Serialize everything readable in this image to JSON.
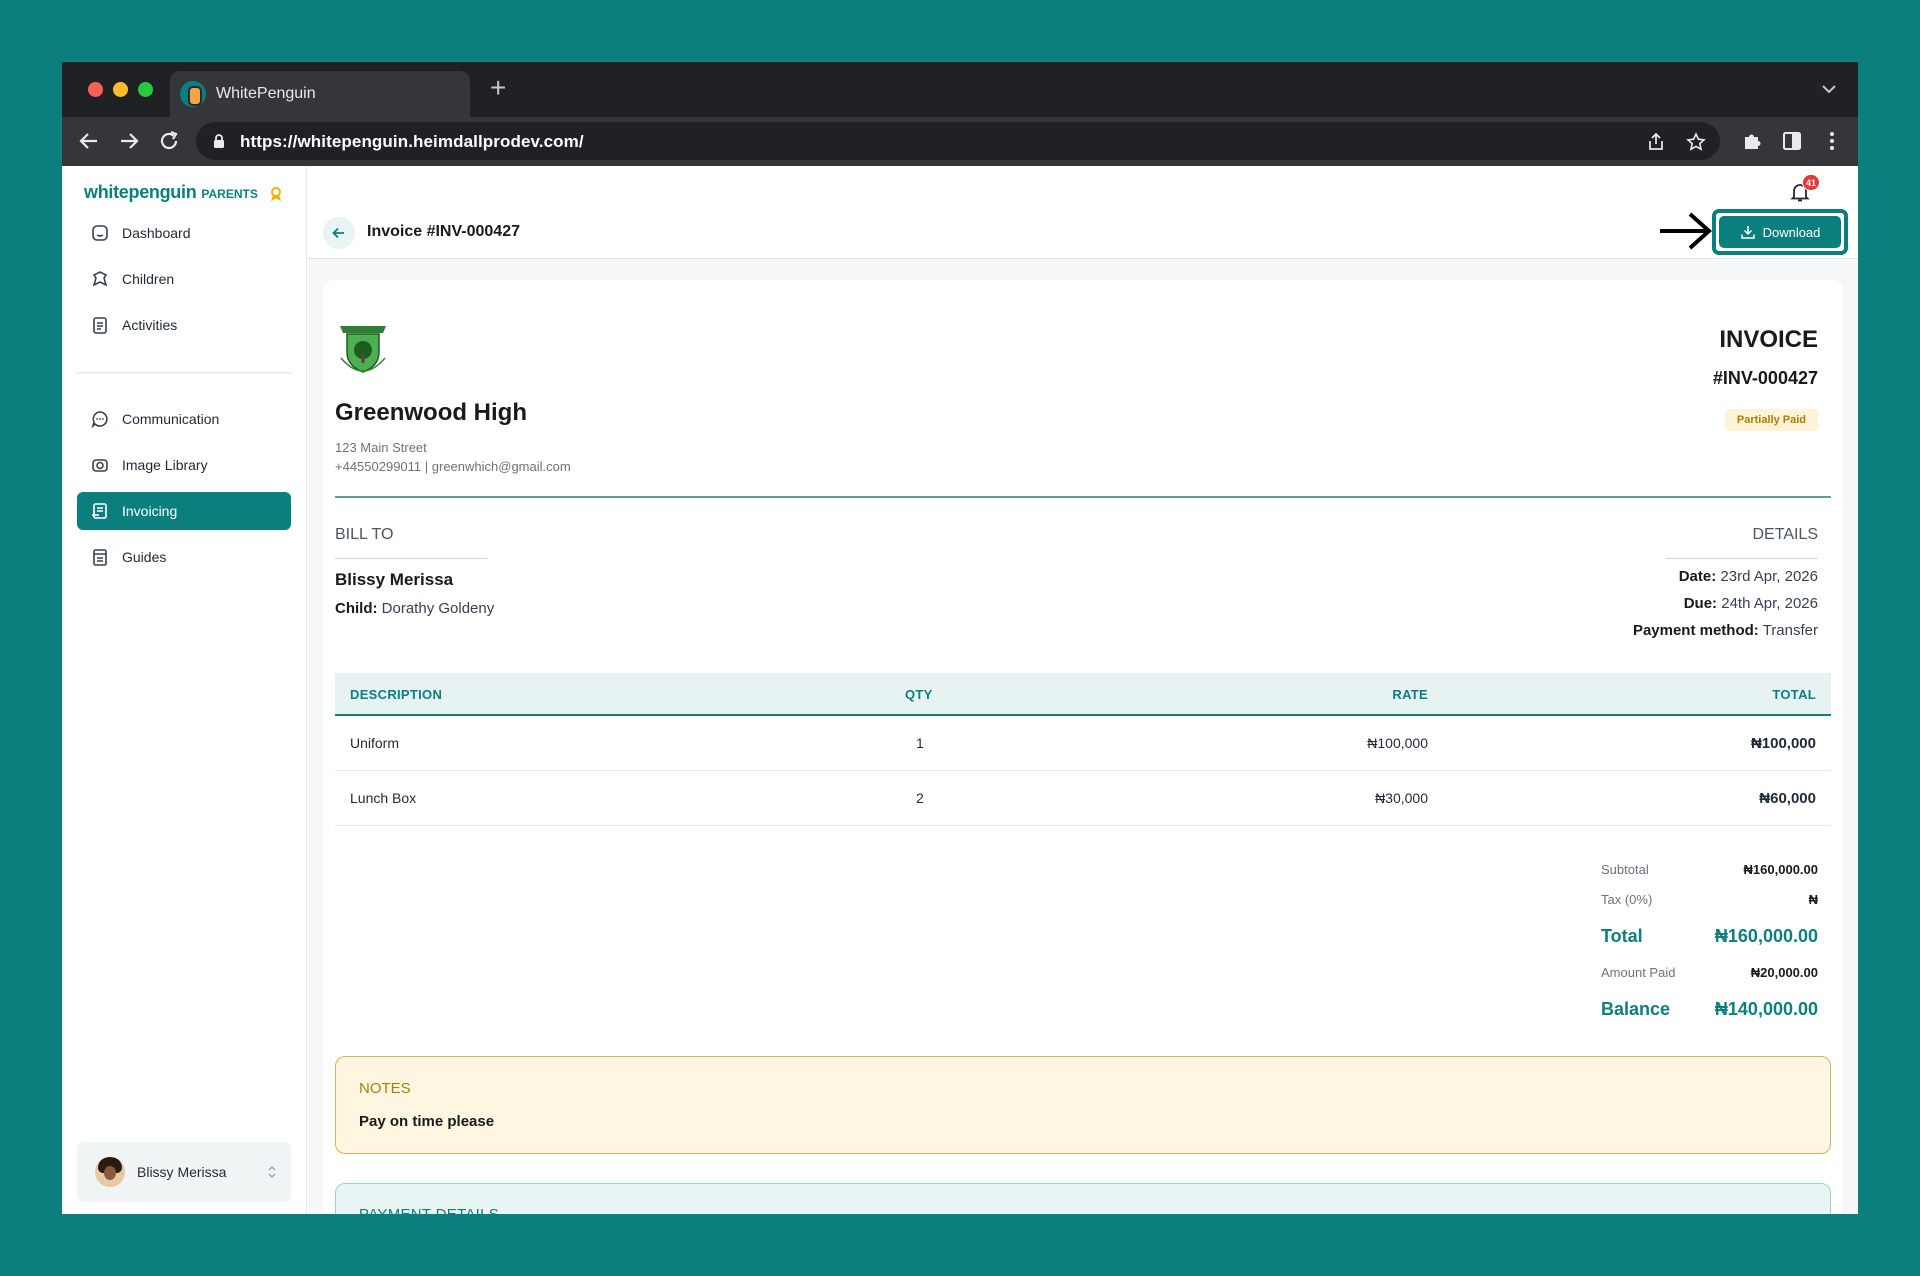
{
  "browser": {
    "tab_title": "WhitePenguin",
    "url": "https://whitepenguin.heimdallprodev.com/"
  },
  "sidebar": {
    "brand_name": "whitepenguin",
    "brand_sub": "PARENTS",
    "items": [
      {
        "label": "Dashboard",
        "icon": "dashboard-icon"
      },
      {
        "label": "Children",
        "icon": "children-icon"
      },
      {
        "label": "Activities",
        "icon": "activities-icon"
      },
      {
        "label": "Communication",
        "icon": "chat-icon"
      },
      {
        "label": "Image Library",
        "icon": "camera-icon"
      },
      {
        "label": "Invoicing",
        "icon": "invoice-icon",
        "active": true
      },
      {
        "label": "Guides",
        "icon": "book-icon"
      }
    ],
    "user_name": "Blissy Merissa"
  },
  "header": {
    "notification_count": "41",
    "page_title": "Invoice #INV-000427",
    "download_label": "Download"
  },
  "invoice": {
    "school_name": "Greenwood High",
    "address": "123 Main Street",
    "contact": "+44550299011 | greenwhich@gmail.com",
    "heading": "INVOICE",
    "number": "#INV-000427",
    "status": "Partially Paid",
    "bill_to_heading": "BILL TO",
    "bill_to_name": "Blissy Merissa",
    "child_label": "Child:",
    "child_name": "Dorathy Goldeny",
    "details_heading": "DETAILS",
    "date_label": "Date:",
    "date_value": "23rd Apr, 2026",
    "due_label": "Due:",
    "due_value": "24th Apr, 2026",
    "payment_method_label": "Payment method:",
    "payment_method_value": "Transfer",
    "table": {
      "headers": [
        "DESCRIPTION",
        "QTY",
        "RATE",
        "TOTAL"
      ],
      "rows": [
        {
          "description": "Uniform",
          "qty": "1",
          "rate": "₦100,000",
          "total": "₦100,000"
        },
        {
          "description": "Lunch Box",
          "qty": "2",
          "rate": "₦30,000",
          "total": "₦60,000"
        }
      ]
    },
    "summary": {
      "subtotal_label": "Subtotal",
      "subtotal_value": "₦160,000.00",
      "tax_label": "Tax (0%)",
      "tax_value": "₦",
      "total_label": "Total",
      "total_value": "₦160,000.00",
      "paid_label": "Amount Paid",
      "paid_value": "₦20,000.00",
      "balance_label": "Balance",
      "balance_value": "₦140,000.00"
    },
    "notes_heading": "NOTES",
    "notes_text": "Pay on time please",
    "payment_details_heading": "PAYMENT DETAILS"
  }
}
